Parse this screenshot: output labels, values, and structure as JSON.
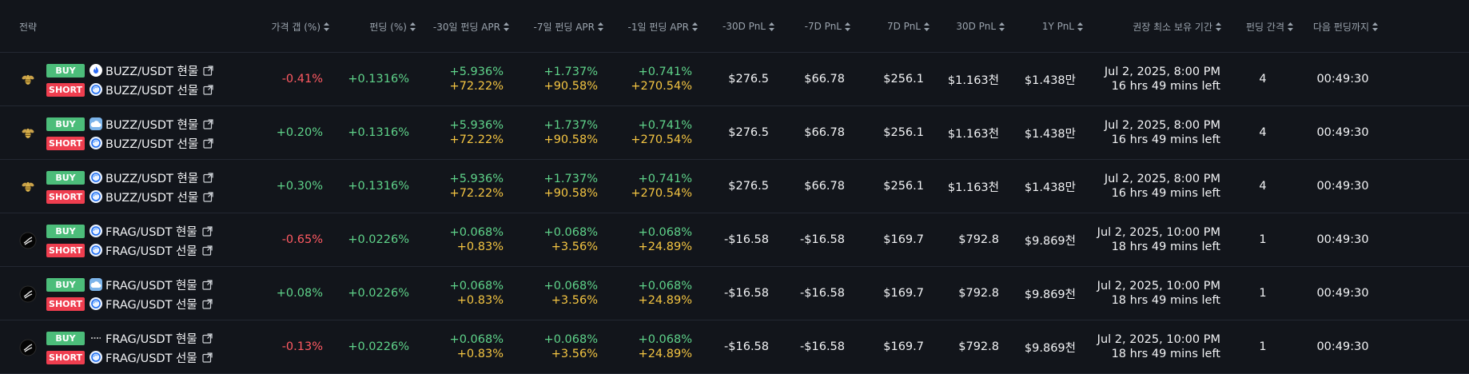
{
  "headers": {
    "strategy": "전략",
    "price_gap": "가격 갭 (%)",
    "funding": "펀딩 (%)",
    "apr30": "-30일 펀딩 APR",
    "apr7": "-7일 펀딩 APR",
    "apr1": "-1일 펀딩 APR",
    "pnl30neg": "-30D PnL",
    "pnl7neg": "-7D PnL",
    "pnl7": "7D PnL",
    "pnl30": "30D PnL",
    "pnl1y": "1Y PnL",
    "hold": "권장 최소 보유 기간",
    "interval": "펀딩 간격",
    "next": "다음 펀딩까지"
  },
  "rows": [
    {
      "logo": "bee-icon",
      "buy_label": "BUY",
      "buy_exchange_icon": "flame-exchange-icon",
      "buy_pair": "BUZZ/USDT 현물",
      "short_label": "SHORT",
      "short_exchange_icon": "swirl-exchange-icon",
      "short_pair": "BUZZ/USDT 선물",
      "price_gap": "-0.41%",
      "price_gap_dir": "neg",
      "funding": "+0.1316%",
      "apr30_a": "+5.936%",
      "apr30_b": "+72.22%",
      "apr7_a": "+1.737%",
      "apr7_b": "+90.58%",
      "apr1_a": "+0.741%",
      "apr1_b": "+270.54%",
      "pnl30neg": "$276.5",
      "pnl7neg": "$66.78",
      "pnl7": "$256.1",
      "pnl30": "$1.163천",
      "pnl1y": "$1.438만",
      "hold_date": "Jul 2, 2025, 8:00 PM",
      "hold_left": "16 hrs 49 mins left",
      "interval": "4",
      "next": "00:49:30"
    },
    {
      "logo": "bee-icon",
      "buy_label": "BUY",
      "buy_exchange_icon": "cloud-exchange-icon",
      "buy_pair": "BUZZ/USDT 현물",
      "short_label": "SHORT",
      "short_exchange_icon": "swirl-exchange-icon",
      "short_pair": "BUZZ/USDT 선물",
      "price_gap": "+0.20%",
      "price_gap_dir": "pos",
      "funding": "+0.1316%",
      "apr30_a": "+5.936%",
      "apr30_b": "+72.22%",
      "apr7_a": "+1.737%",
      "apr7_b": "+90.58%",
      "apr1_a": "+0.741%",
      "apr1_b": "+270.54%",
      "pnl30neg": "$276.5",
      "pnl7neg": "$66.78",
      "pnl7": "$256.1",
      "pnl30": "$1.163천",
      "pnl1y": "$1.438만",
      "hold_date": "Jul 2, 2025, 8:00 PM",
      "hold_left": "16 hrs 49 mins left",
      "interval": "4",
      "next": "00:49:30"
    },
    {
      "logo": "bee-icon",
      "buy_label": "BUY",
      "buy_exchange_icon": "swirl-exchange-icon",
      "buy_pair": "BUZZ/USDT 현물",
      "short_label": "SHORT",
      "short_exchange_icon": "swirl-exchange-icon",
      "short_pair": "BUZZ/USDT 선물",
      "price_gap": "+0.30%",
      "price_gap_dir": "pos",
      "funding": "+0.1316%",
      "apr30_a": "+5.936%",
      "apr30_b": "+72.22%",
      "apr7_a": "+1.737%",
      "apr7_b": "+90.58%",
      "apr1_a": "+0.741%",
      "apr1_b": "+270.54%",
      "pnl30neg": "$276.5",
      "pnl7neg": "$66.78",
      "pnl7": "$256.1",
      "pnl30": "$1.163천",
      "pnl1y": "$1.438만",
      "hold_date": "Jul 2, 2025, 8:00 PM",
      "hold_left": "16 hrs 49 mins left",
      "interval": "4",
      "next": "00:49:30"
    },
    {
      "logo": "frag-icon",
      "buy_label": "BUY",
      "buy_exchange_icon": "swirl-exchange-icon",
      "buy_pair": "FRAG/USDT 현물",
      "short_label": "SHORT",
      "short_exchange_icon": "swirl-exchange-icon",
      "short_pair": "FRAG/USDT 선물",
      "price_gap": "-0.65%",
      "price_gap_dir": "neg",
      "funding": "+0.0226%",
      "apr30_a": "+0.068%",
      "apr30_b": "+0.83%",
      "apr7_a": "+0.068%",
      "apr7_b": "+3.56%",
      "apr1_a": "+0.068%",
      "apr1_b": "+24.89%",
      "pnl30neg": "-$16.58",
      "pnl7neg": "-$16.58",
      "pnl7": "$169.7",
      "pnl30": "$792.8",
      "pnl1y": "$9.869천",
      "hold_date": "Jul 2, 2025, 10:00 PM",
      "hold_left": "18 hrs 49 mins left",
      "interval": "1",
      "next": "00:49:30"
    },
    {
      "logo": "frag-icon",
      "buy_label": "BUY",
      "buy_exchange_icon": "cloud-exchange-icon",
      "buy_pair": "FRAG/USDT 현물",
      "short_label": "SHORT",
      "short_exchange_icon": "swirl-exchange-icon",
      "short_pair": "FRAG/USDT 선물",
      "price_gap": "+0.08%",
      "price_gap_dir": "pos",
      "funding": "+0.0226%",
      "apr30_a": "+0.068%",
      "apr30_b": "+0.83%",
      "apr7_a": "+0.068%",
      "apr7_b": "+3.56%",
      "apr1_a": "+0.068%",
      "apr1_b": "+24.89%",
      "pnl30neg": "-$16.58",
      "pnl7neg": "-$16.58",
      "pnl7": "$169.7",
      "pnl30": "$792.8",
      "pnl1y": "$9.869천",
      "hold_date": "Jul 2, 2025, 10:00 PM",
      "hold_left": "18 hrs 49 mins left",
      "interval": "1",
      "next": "00:49:30"
    },
    {
      "logo": "frag-icon",
      "buy_label": "BUY",
      "buy_exchange_icon": "dash-exchange-icon",
      "buy_pair": "FRAG/USDT 현물",
      "short_label": "SHORT",
      "short_exchange_icon": "swirl-exchange-icon",
      "short_pair": "FRAG/USDT 선물",
      "price_gap": "-0.13%",
      "price_gap_dir": "neg",
      "funding": "+0.0226%",
      "apr30_a": "+0.068%",
      "apr30_b": "+0.83%",
      "apr7_a": "+0.068%",
      "apr7_b": "+3.56%",
      "apr1_a": "+0.068%",
      "apr1_b": "+24.89%",
      "pnl30neg": "-$16.58",
      "pnl7neg": "-$16.58",
      "pnl7": "$169.7",
      "pnl30": "$792.8",
      "pnl1y": "$9.869천",
      "hold_date": "Jul 2, 2025, 10:00 PM",
      "hold_left": "18 hrs 49 mins left",
      "interval": "1",
      "next": "00:49:30"
    }
  ],
  "colors": {
    "positive": "#5fd38a",
    "negative": "#ff5a62",
    "apr_secondary": "#f4c542",
    "buy_badge": "#4cbd7a",
    "short_badge": "#ef3e4f",
    "background": "#12151b"
  }
}
